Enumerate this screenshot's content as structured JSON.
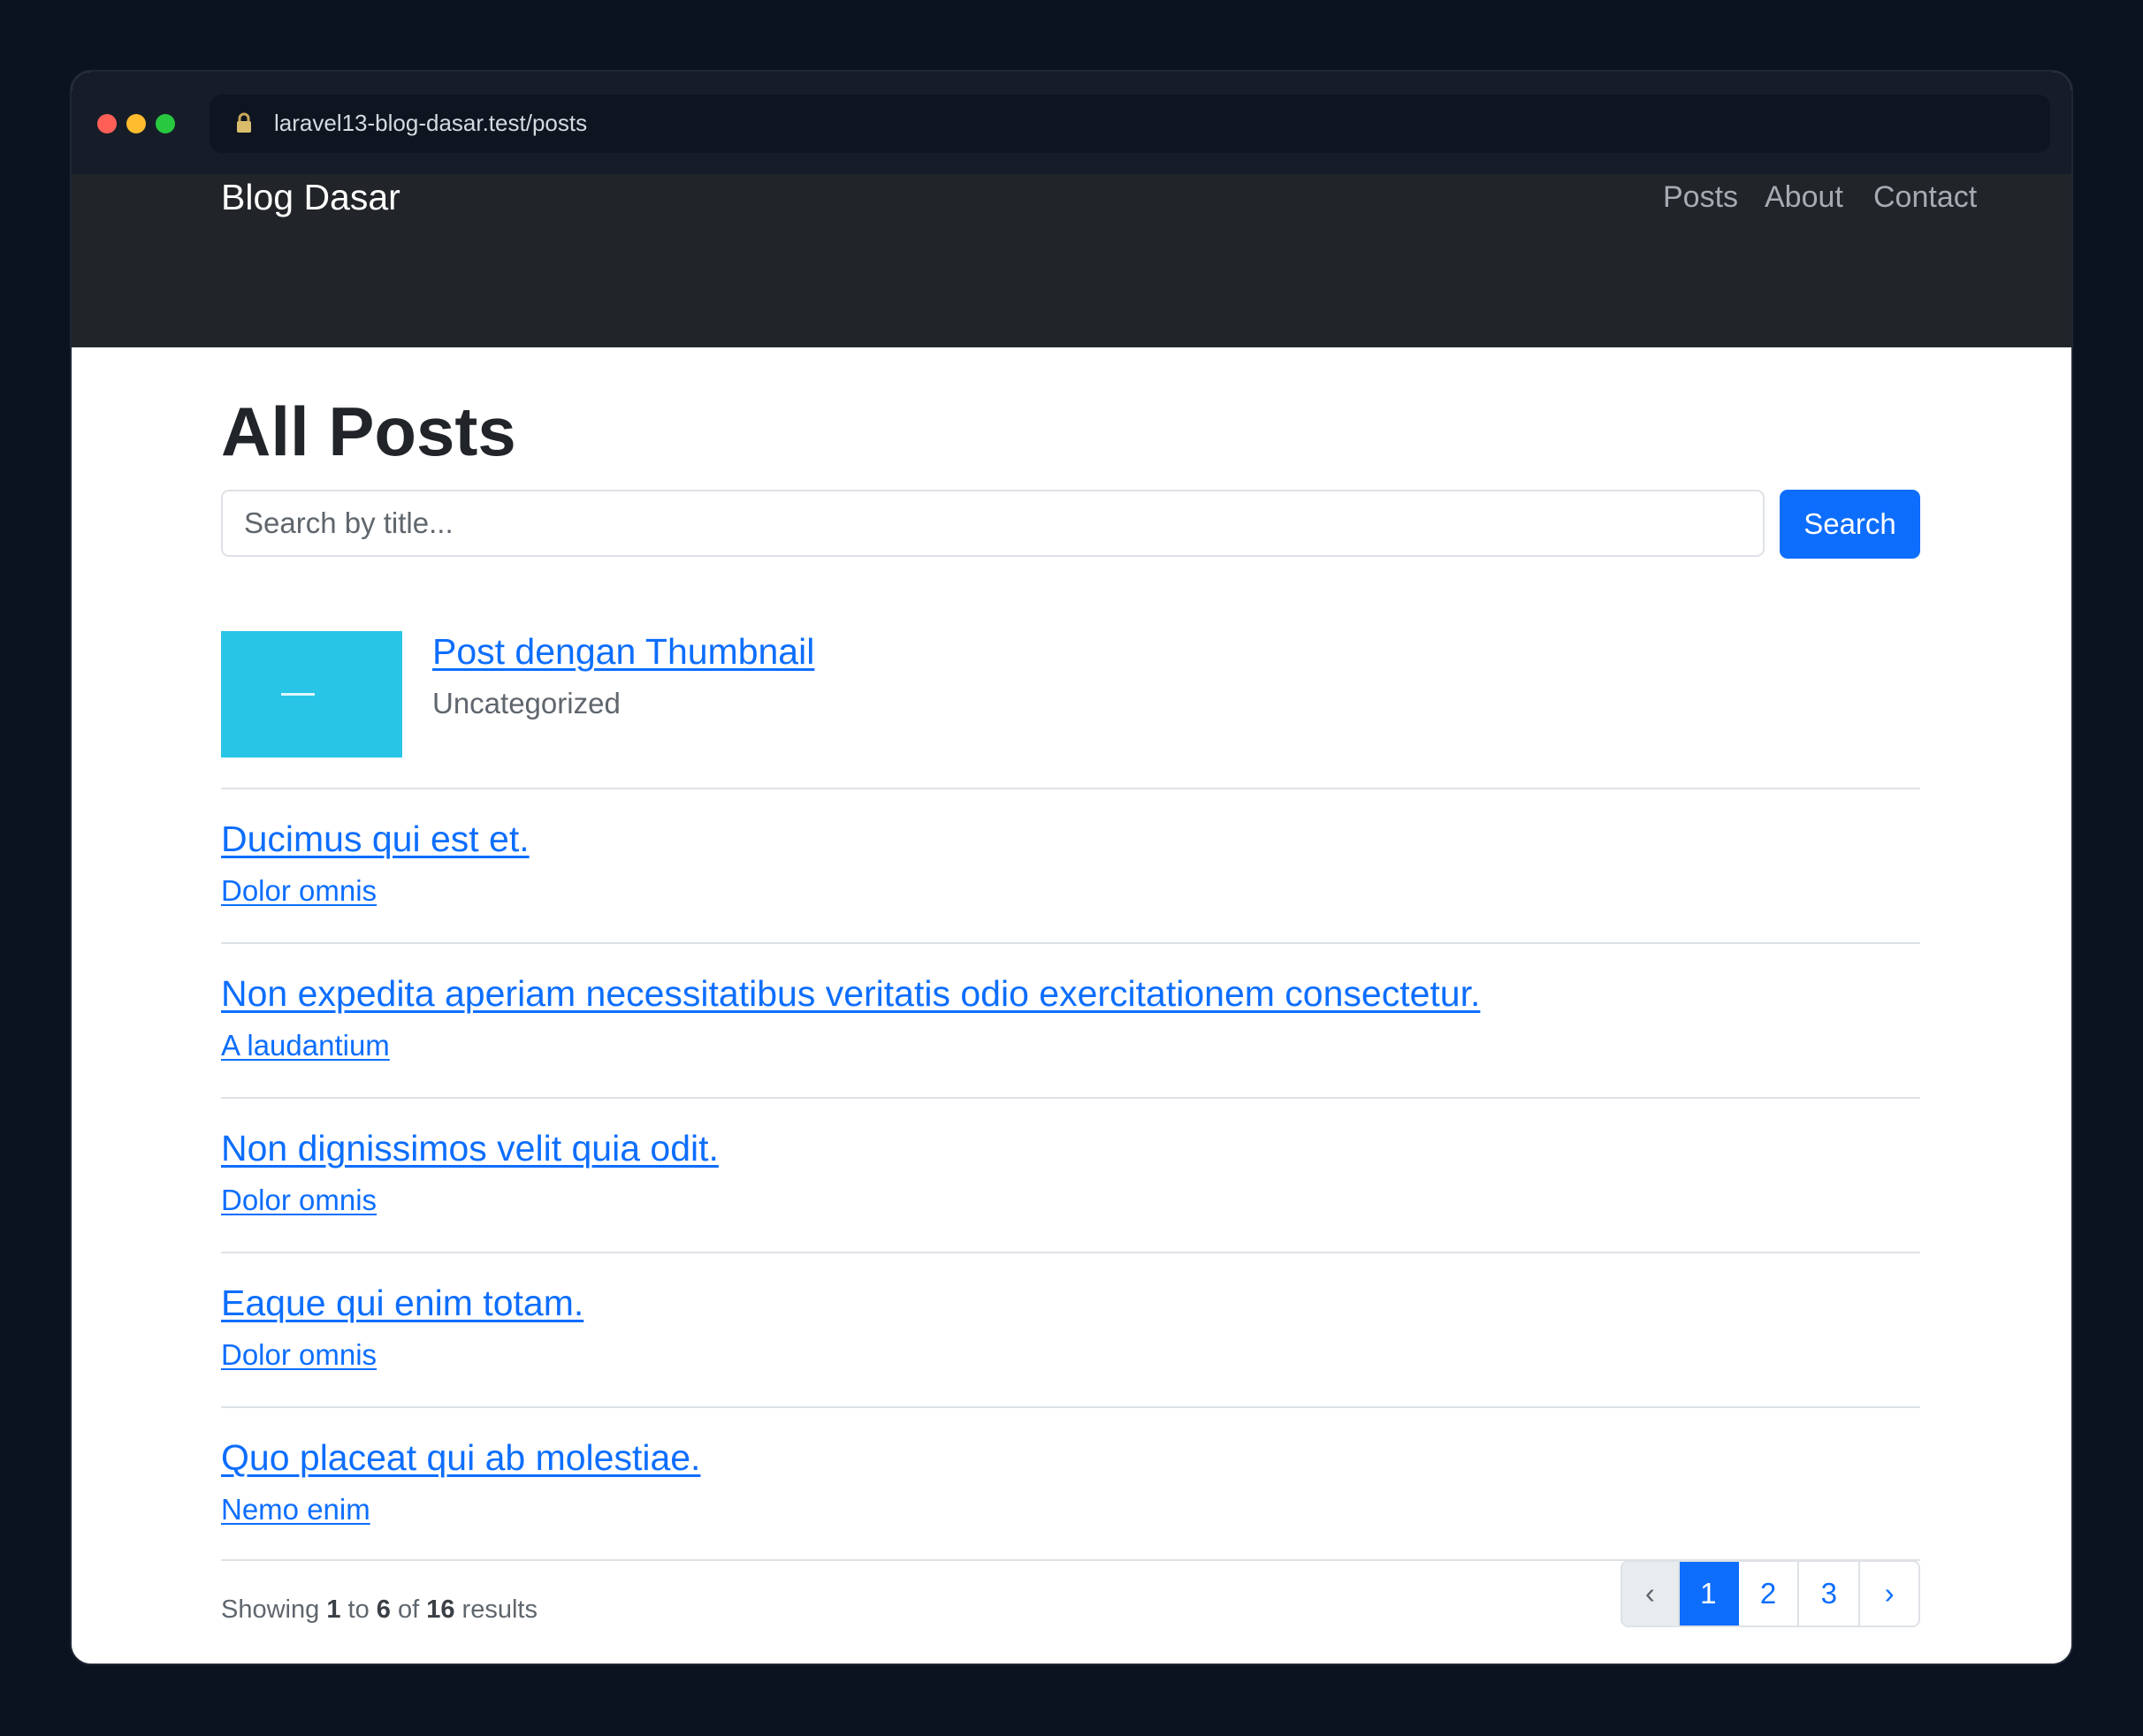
{
  "browser": {
    "url": "laravel13-blog-dasar.test/posts",
    "traffic_lights": {
      "close": "#ff5f57",
      "minimize": "#febc2e",
      "zoom": "#28c840"
    }
  },
  "navbar": {
    "brand": "Blog Dasar",
    "links": [
      "Posts",
      "About",
      "Contact"
    ]
  },
  "main": {
    "title": "All Posts",
    "search": {
      "placeholder": "Search by title...",
      "value": "",
      "button_label": "Search"
    },
    "posts": [
      {
        "title": "Post dengan Thumbnail",
        "category": "Uncategorized",
        "has_thumbnail": true,
        "category_linked": false
      },
      {
        "title": "Ducimus qui est et.",
        "category": "Dolor omnis",
        "has_thumbnail": false,
        "category_linked": true
      },
      {
        "title": "Non expedita aperiam necessitatibus veritatis odio exercitationem consectetur.",
        "category": "A laudantium",
        "has_thumbnail": false,
        "category_linked": true
      },
      {
        "title": "Non dignissimos velit quia odit.",
        "category": "Dolor omnis",
        "has_thumbnail": false,
        "category_linked": true
      },
      {
        "title": "Eaque qui enim totam.",
        "category": "Dolor omnis",
        "has_thumbnail": false,
        "category_linked": true
      },
      {
        "title": "Quo placeat qui ab molestiae.",
        "category": "Nemo enim",
        "has_thumbnail": false,
        "category_linked": true
      }
    ],
    "results": {
      "prefix": "Showing",
      "from": "1",
      "to_word": "to",
      "to": "6",
      "of_word": "of",
      "total": "16",
      "suffix": "results"
    },
    "pagination": {
      "prev": "‹",
      "pages": [
        "1",
        "2",
        "3"
      ],
      "current": "1",
      "next": "›"
    }
  },
  "colors": {
    "primary": "#0d6efd",
    "navbar_bg": "#212529",
    "thumbnail": "#29c5e6",
    "page_bg": "#0b1220"
  },
  "icons": {
    "lock": "lock-icon",
    "prev": "chevron-left-icon",
    "next": "chevron-right-icon"
  }
}
